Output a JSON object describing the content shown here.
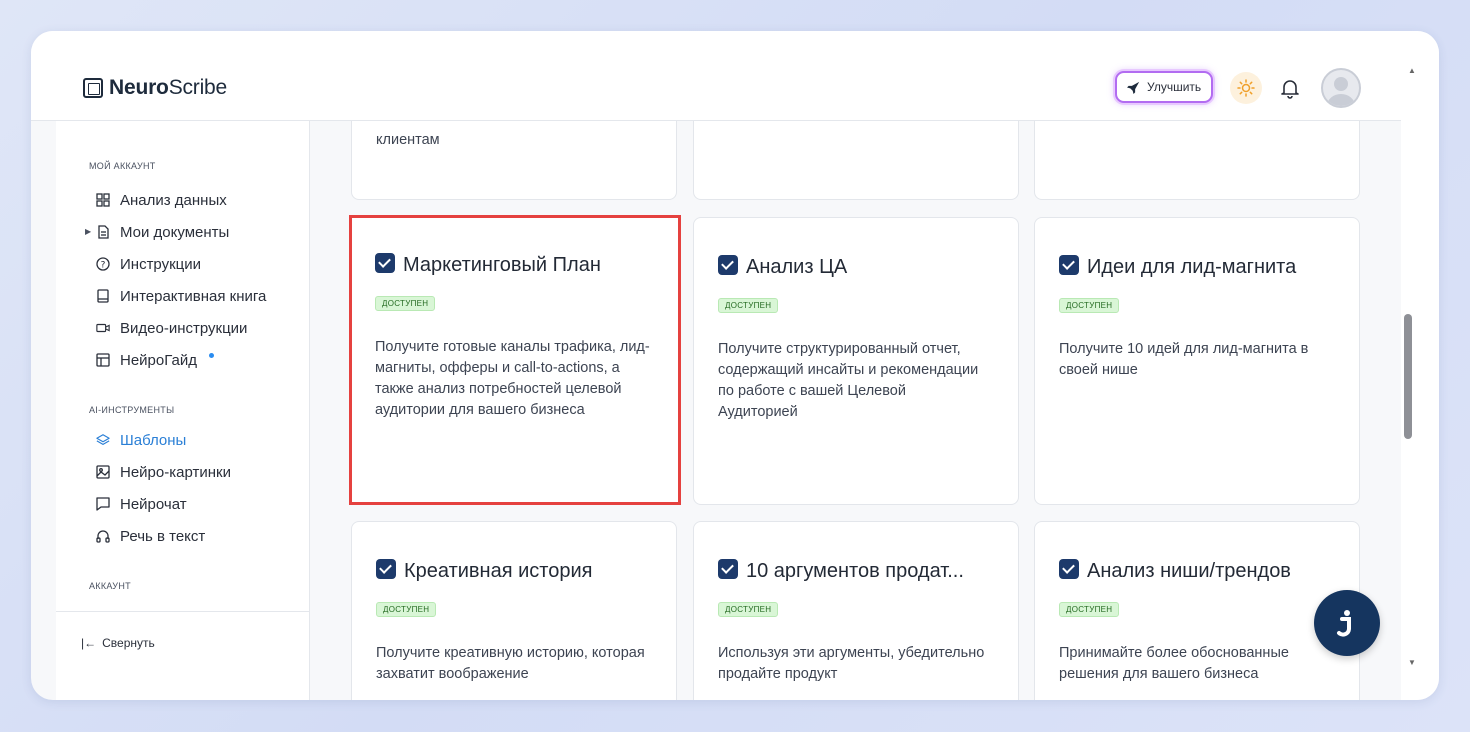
{
  "header": {
    "logo_bold": "Neuro",
    "logo_rest": "Scribe",
    "upgrade_label": "Улучшить"
  },
  "sidebar": {
    "section_account": "МОЙ АККАУНТ",
    "items_account": [
      {
        "label": "Анализ данных",
        "icon": "grid-icon"
      },
      {
        "label": "Мои документы",
        "icon": "document-icon"
      },
      {
        "label": "Инструкции",
        "icon": "help-icon"
      },
      {
        "label": "Интерактивная книга",
        "icon": "book-icon"
      },
      {
        "label": "Видео-инструкции",
        "icon": "video-icon"
      },
      {
        "label": "НейроГайд",
        "icon": "guide-icon"
      }
    ],
    "section_ai": "AI-ИНСТРУМЕНТЫ",
    "items_ai": [
      {
        "label": "Шаблоны",
        "icon": "layers-icon"
      },
      {
        "label": "Нейро-картинки",
        "icon": "image-icon"
      },
      {
        "label": "Нейрочат",
        "icon": "chat-icon"
      },
      {
        "label": "Речь в текст",
        "icon": "headphones-icon"
      }
    ],
    "section_account2": "АККАУНТ",
    "collapse_label": "Свернуть",
    "active_color": "#2a7fd6"
  },
  "main": {
    "top_row_partial_text": "клиентам",
    "cards": [
      {
        "title": "Маркетинговый План",
        "badge": "ДОСТУПЕН",
        "desc": "Получите готовые каналы трафика, лид-магниты, офферы и call-to-actions, а также анализ потребностей целевой аудитории для вашего бизнеса"
      },
      {
        "title": "Анализ ЦА",
        "badge": "ДОСТУПЕН",
        "desc": "Получите структурированный отчет, содержащий инсайты и рекомендации по работе с вашей Целевой Аудиторией"
      },
      {
        "title": "Идеи для лид-магнита",
        "badge": "ДОСТУПЕН",
        "desc": "Получите 10 идей для лид-магнита в своей нише"
      },
      {
        "title": "Креативная история",
        "badge": "ДОСТУПЕН",
        "desc": "Получите креативную историю, которая захватит воображение"
      },
      {
        "title": "10 аргументов продат...",
        "badge": "ДОСТУПЕН",
        "desc": "Используя эти аргументы, убедительно продайте продукт"
      },
      {
        "title": "Анализ ниши/трендов",
        "badge": "ДОСТУПЕН",
        "desc": "Принимайте более обоснованные решения для вашего бизнеса"
      }
    ]
  },
  "fab_icon": "chat-assistant-icon",
  "highlight_color": "#e5413f"
}
